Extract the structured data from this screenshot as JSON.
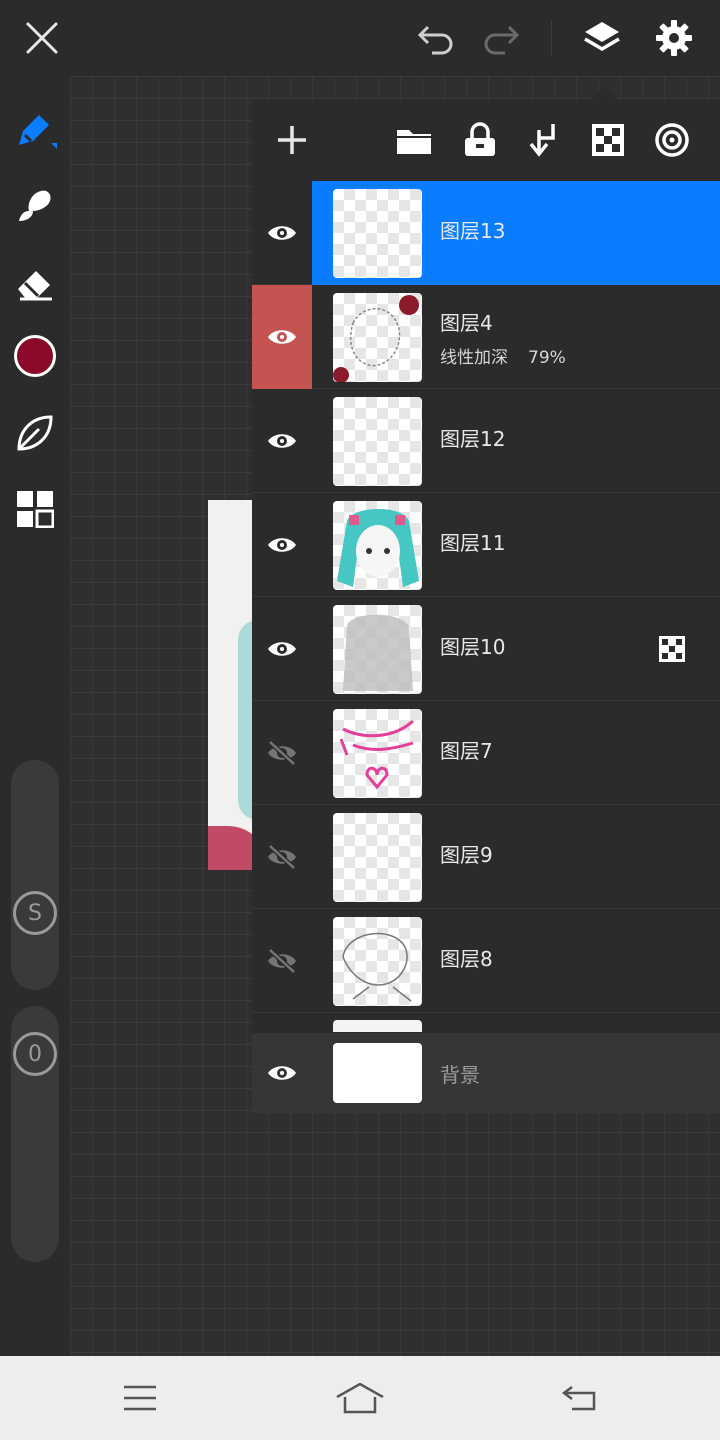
{
  "colors": {
    "accent": "#0a7cff",
    "current_brush_color": "#8b0a2a",
    "clip_indicator": "#c45352",
    "panel_bg": "#2b2b2b",
    "navbar_bg": "#ededed"
  },
  "topbar": {
    "icons": [
      "close-icon",
      "undo-icon",
      "redo-icon",
      "layers-icon",
      "settings-icon"
    ]
  },
  "toolbar": {
    "tools": [
      "pen-tool-icon",
      "smudge-tool-icon",
      "eraser-tool-icon",
      "color-swatch",
      "leaf-tool-icon",
      "grid-tool-icon"
    ],
    "size_slider_label": "S",
    "opacity_slider_label": "0"
  },
  "layers_panel": {
    "toolbar_icons": [
      "add-layer-icon",
      "folder-icon",
      "lock-icon",
      "merge-down-icon",
      "transparency-icon",
      "blend-icon"
    ],
    "layers": [
      {
        "name": "图层13",
        "visible": true,
        "selected": true,
        "sub": ""
      },
      {
        "name": "图层4",
        "visible": true,
        "clip": true,
        "blend": "线性加深",
        "opacity": "79%"
      },
      {
        "name": "图层12",
        "visible": true
      },
      {
        "name": "图层11",
        "visible": true
      },
      {
        "name": "图层10",
        "visible": true,
        "alpha_lock_badge": true
      },
      {
        "name": "图层7",
        "visible": false
      },
      {
        "name": "图层9",
        "visible": false
      },
      {
        "name": "图层8",
        "visible": false
      }
    ],
    "background": {
      "name": "背景",
      "visible": true
    }
  },
  "navbar": {
    "icons": [
      "menu-icon",
      "home-icon",
      "back-icon"
    ]
  }
}
